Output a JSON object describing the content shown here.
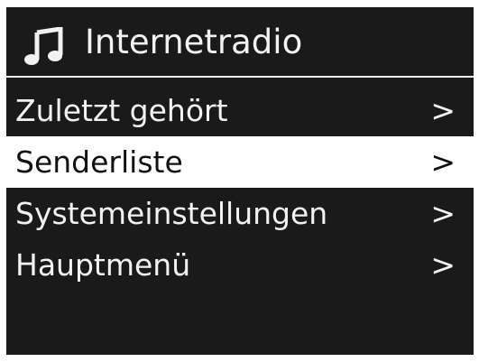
{
  "header": {
    "icon": "music-note-icon",
    "title": "Internetradio"
  },
  "menu": {
    "items": [
      {
        "label": "Zuletzt gehört",
        "chevron": ">",
        "selected": false
      },
      {
        "label": "Senderliste",
        "chevron": ">",
        "selected": true
      },
      {
        "label": "Systemeinstellungen",
        "chevron": ">",
        "selected": false
      },
      {
        "label": "Hauptmenü",
        "chevron": ">",
        "selected": false
      }
    ]
  },
  "colors": {
    "background": "#1a1a1a",
    "text": "#f2f2f2",
    "highlight": "#ffffff",
    "highlight_text": "#111111"
  }
}
